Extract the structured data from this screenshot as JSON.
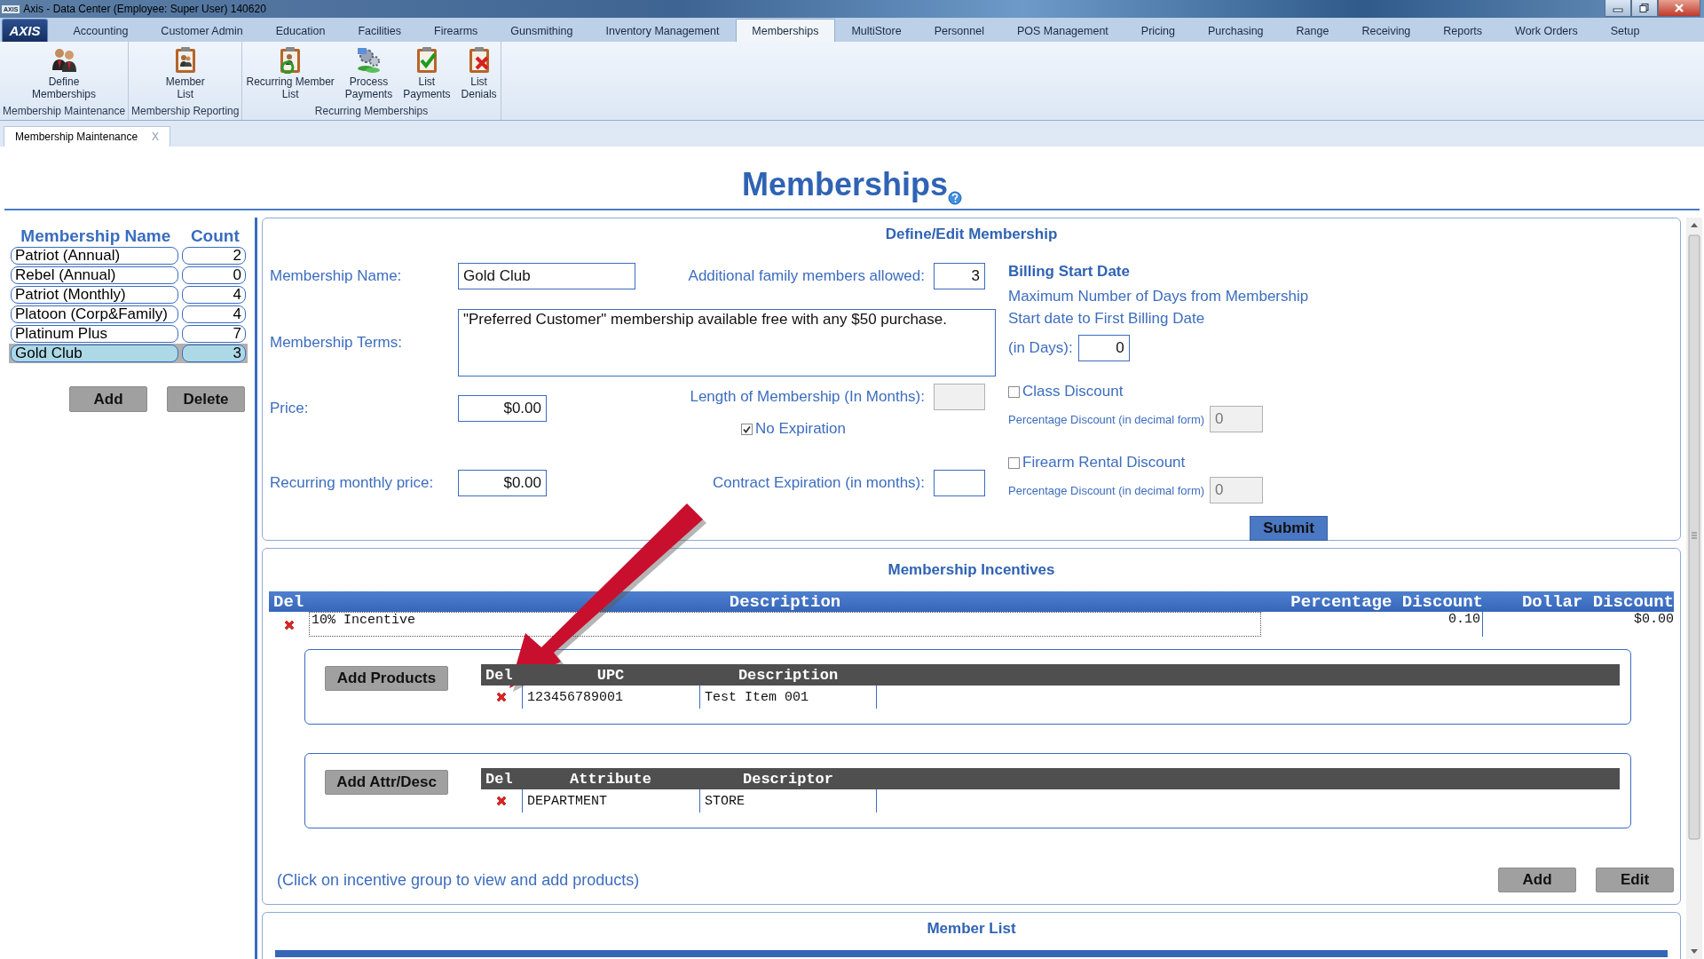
{
  "window": {
    "title": "Axis - Data Center  (Employee: Super User) 140620",
    "icon_text": "AXIS",
    "logo": "AXIS"
  },
  "menu_tabs": [
    {
      "label": "Accounting",
      "selected": false
    },
    {
      "label": "Customer Admin",
      "selected": false
    },
    {
      "label": "Education",
      "selected": false
    },
    {
      "label": "Facilities",
      "selected": false
    },
    {
      "label": "Firearms",
      "selected": false
    },
    {
      "label": "Gunsmithing",
      "selected": false
    },
    {
      "label": "Inventory Management",
      "selected": false
    },
    {
      "label": "Memberships",
      "selected": true
    },
    {
      "label": "MultiStore",
      "selected": false
    },
    {
      "label": "Personnel",
      "selected": false
    },
    {
      "label": "POS Management",
      "selected": false
    },
    {
      "label": "Pricing",
      "selected": false
    },
    {
      "label": "Purchasing",
      "selected": false
    },
    {
      "label": "Range",
      "selected": false
    },
    {
      "label": "Receiving",
      "selected": false
    },
    {
      "label": "Reports",
      "selected": false
    },
    {
      "label": "Work Orders",
      "selected": false
    },
    {
      "label": "Setup",
      "selected": false
    }
  ],
  "ribbon_groups": [
    {
      "label": "Membership Maintenance",
      "buttons": [
        {
          "kind": "people",
          "label": "Define\nMemberships"
        }
      ]
    },
    {
      "label": "Membership Reporting",
      "buttons": [
        {
          "kind": "clipboard",
          "label": "Member\nList"
        }
      ]
    },
    {
      "label": "Recurring Memberships",
      "buttons": [
        {
          "kind": "clipboard-refresh",
          "label": "Recurring Member\nList"
        },
        {
          "kind": "gears",
          "label": "Process\nPayments"
        },
        {
          "kind": "clipboard-check",
          "label": "List\nPayments"
        },
        {
          "kind": "clipboard-x",
          "label": "List\nDenials"
        }
      ]
    }
  ],
  "doc_tabs": [
    {
      "label": "Membership Maintenance",
      "close": "X",
      "selected": true
    }
  ],
  "page_title": "Memberships",
  "memberships": {
    "columns": [
      "Membership Name",
      "Count"
    ],
    "rows": [
      {
        "name": "Patriot (Annual)",
        "count": "2",
        "selected": false
      },
      {
        "name": "Rebel (Annual)",
        "count": "0",
        "selected": false
      },
      {
        "name": "Patriot (Monthly)",
        "count": "4",
        "selected": false
      },
      {
        "name": "Platoon (Corp&Family)",
        "count": "4",
        "selected": false
      },
      {
        "name": "Platinum Plus",
        "count": "7",
        "selected": false
      },
      {
        "name": "Gold Club",
        "count": "3",
        "selected": true
      }
    ],
    "buttons": [
      "Add",
      "Delete"
    ]
  },
  "define_form": {
    "title": "Define/Edit Membership",
    "membership_name": {
      "label": "Membership Name:",
      "value": "Gold Club"
    },
    "family_members": {
      "label": "Additional family members allowed:",
      "value": "3"
    },
    "terms": {
      "label": "Membership Terms:",
      "value": "\"Preferred Customer\" membership available free with any $50 purchase."
    },
    "price": {
      "label": "Price:",
      "value": "$0.00"
    },
    "length": {
      "label": "Length of Membership (In Months):",
      "disabled": true
    },
    "no_expiration": {
      "label": "No Expiration",
      "checked": true
    },
    "recurring_price": {
      "label": "Recurring monthly price:",
      "value": "$0.00"
    },
    "contract_expiration": {
      "label": "Contract Expiration (in months):"
    },
    "billing": {
      "title": "Billing Start Date",
      "description": "Maximum Number of Days from Membership Start date to First Billing Date",
      "days_label": "(in Days):",
      "days_value": "0"
    },
    "discounts": [
      {
        "label": "Class Discount",
        "checked": false,
        "pct_label": "Percentage Discount (in decimal form)",
        "pct_value": "0",
        "disabled": true
      },
      {
        "label": "Firearm Rental Discount",
        "checked": false,
        "pct_label": "Percentage Discount (in decimal form)",
        "pct_value": "0",
        "disabled": true
      }
    ],
    "submit": "Submit"
  },
  "incentives": {
    "title": "Membership Incentives",
    "columns": [
      "Del",
      "Description",
      "Percentage Discount",
      "Dollar Discount"
    ],
    "rows": [
      {
        "description": "10% Incentive",
        "percentage": "0.10",
        "dollar": "$0.00"
      }
    ],
    "products": {
      "button": "Add Products",
      "columns": [
        "Del",
        "UPC",
        "Description"
      ],
      "rows": [
        {
          "upc": "123456789001",
          "description": "Test Item 001"
        }
      ]
    },
    "attributes": {
      "button": "Add Attr/Desc",
      "columns": [
        "Del",
        "Attribute",
        "Descriptor"
      ],
      "rows": [
        {
          "attribute": "DEPARTMENT",
          "descriptor": "STORE"
        }
      ]
    },
    "hint": "(Click on incentive group to view and add products)",
    "buttons": [
      "Add",
      "Edit"
    ]
  },
  "member_list": {
    "title": "Member List"
  }
}
